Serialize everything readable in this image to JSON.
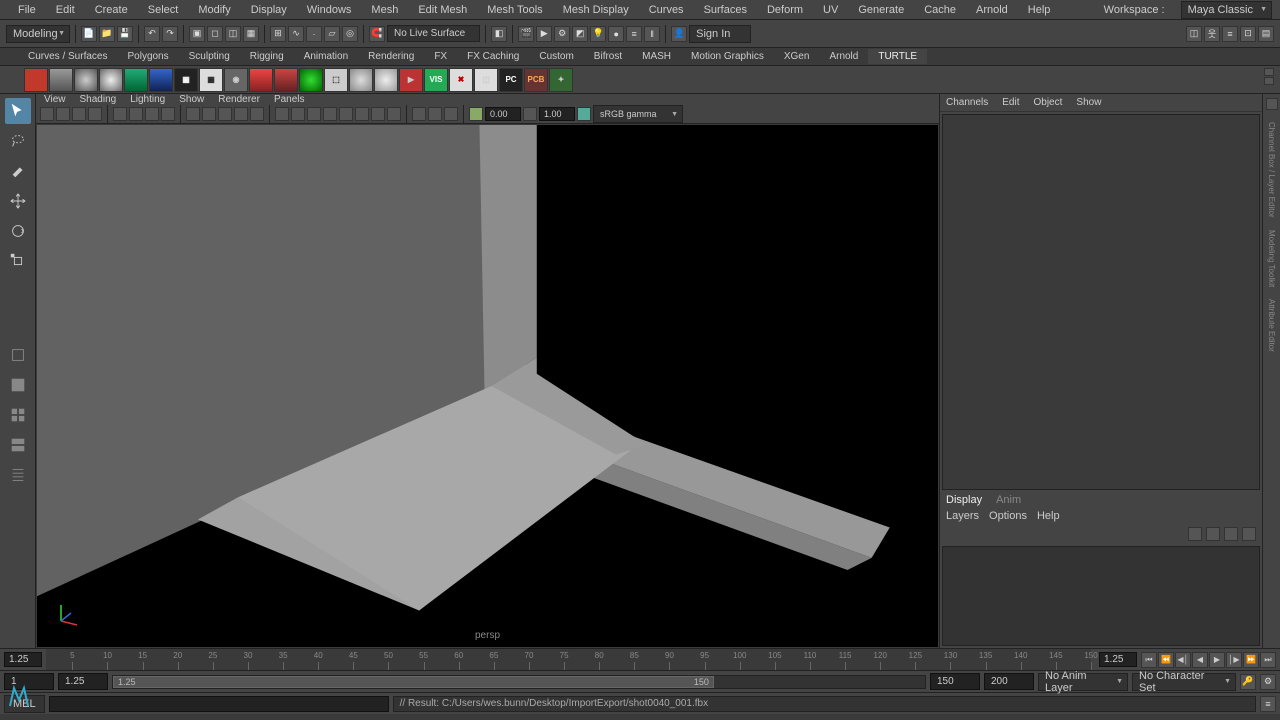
{
  "menu": [
    "File",
    "Edit",
    "Create",
    "Select",
    "Modify",
    "Display",
    "Windows",
    "Mesh",
    "Edit Mesh",
    "Mesh Tools",
    "Mesh Display",
    "Curves",
    "Surfaces",
    "Deform",
    "UV",
    "Generate",
    "Cache",
    "Arnold",
    "Help"
  ],
  "workspace": {
    "label": "Workspace :",
    "value": "Maya Classic"
  },
  "menuset": "Modeling",
  "liveSurface": "No Live Surface",
  "signin": "Sign In",
  "shelves": [
    "Curves / Surfaces",
    "Polygons",
    "Sculpting",
    "Rigging",
    "Animation",
    "Rendering",
    "FX",
    "FX Caching",
    "Custom",
    "Bifrost",
    "MASH",
    "Motion Graphics",
    "XGen",
    "Arnold",
    "TURTLE"
  ],
  "activeShelf": 14,
  "panelMenu": [
    "View",
    "Shading",
    "Lighting",
    "Show",
    "Renderer",
    "Panels"
  ],
  "exposure": "0.00",
  "gamma": "1.00",
  "colorSpace": "sRGB gamma",
  "channelTabs": [
    "Channels",
    "Edit",
    "Object",
    "Show"
  ],
  "displayTabs": {
    "display": "Display",
    "anim": "Anim"
  },
  "layerTabs": [
    "Layers",
    "Options",
    "Help"
  ],
  "timeline": {
    "start": 1,
    "startVisible": 1.25,
    "end": 200,
    "endVisible": 150,
    "current": 1.25,
    "curFrame": "1.25"
  },
  "playback": {
    "animLayer": "No Anim Layer",
    "charSet": "No Character Set"
  },
  "cmd": {
    "lang": "MEL",
    "result": "// Result: C:/Users/wes.bunn/Desktop/ImportExport/shot0040_001.fbx"
  },
  "persp": "persp",
  "rangeKnob": "1.25",
  "rightRail": [
    "Channel Box / Layer Editor",
    "Modeling Toolkit",
    "Attribute Editor"
  ]
}
